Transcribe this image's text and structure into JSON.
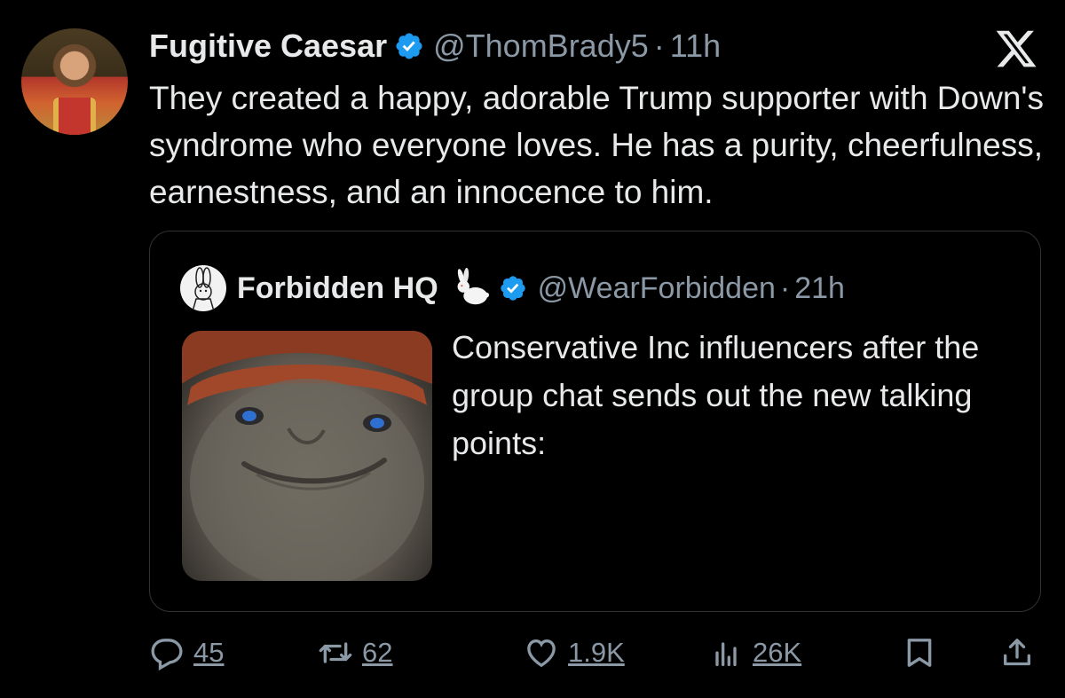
{
  "tweet": {
    "author_name": "Fugitive Caesar",
    "handle": "@ThomBrady5",
    "separator": "·",
    "time": "11h",
    "text": "They created a happy, adorable Trump supporter with Down's syndrome who everyone loves. He has a purity, cheerfulness, earnestness, and an innocence to him."
  },
  "quote": {
    "author_name": "Forbidden HQ",
    "handle": "@WearForbidden",
    "separator": "·",
    "time": "21h",
    "text": "Conservative Inc influencers after the group chat sends out the new talking points:"
  },
  "actions": {
    "replies": "45",
    "reposts": "62",
    "likes": "1.9K",
    "views": "26K"
  },
  "icons": {
    "verified": "verified-badge-icon",
    "x_logo": "x-logo-icon",
    "reply": "reply-icon",
    "repost": "repost-icon",
    "like": "heart-icon",
    "views": "bar-chart-icon",
    "bookmark": "bookmark-icon",
    "share": "share-icon"
  },
  "colors": {
    "background": "#000000",
    "text": "#e7e9ea",
    "muted": "#8b98a5",
    "verified": "#1d9bf0",
    "border": "#2f3336"
  }
}
